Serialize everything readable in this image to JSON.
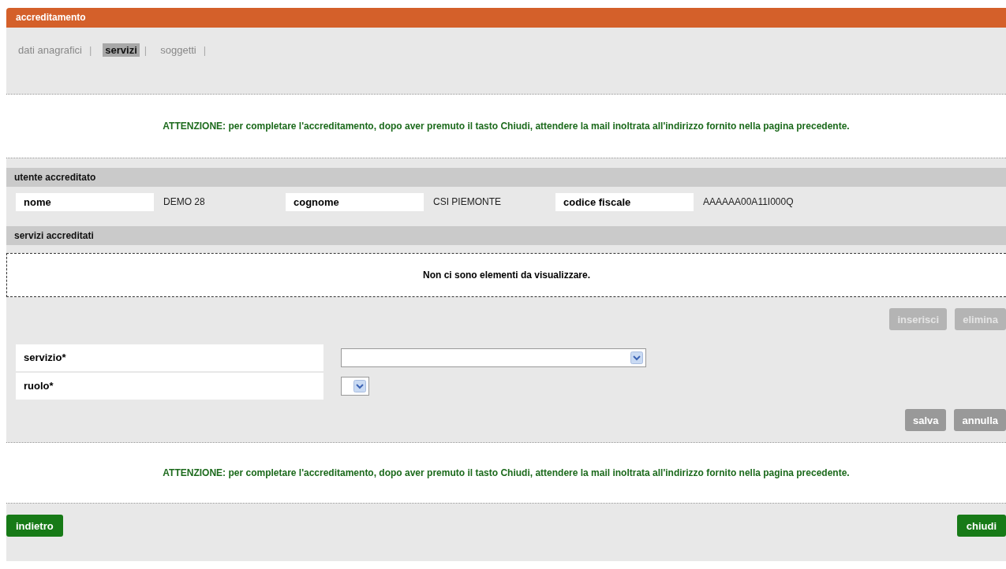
{
  "window": {
    "title": "accreditamento"
  },
  "tabs": [
    {
      "label": "dati anagrafici",
      "selected": false,
      "separator": "|"
    },
    {
      "label": "servizi",
      "selected": true,
      "separator": "|"
    },
    {
      "label": "soggetti",
      "selected": false,
      "separator": "|"
    }
  ],
  "notice_top": "ATTENZIONE: per completare l'accreditamento, dopo aver premuto il tasto Chiudi, attendere la mail inoltrata all'indirizzo fornito nella pagina precedente.",
  "user_section": {
    "title": "utente accreditato",
    "fields": [
      {
        "label": "nome",
        "value": "DEMO 28"
      },
      {
        "label": "cognome",
        "value": "CSI PIEMONTE"
      },
      {
        "label": "codice fiscale",
        "value": "AAAAAA00A11I000Q"
      }
    ]
  },
  "services_section": {
    "title": "servizi accreditati",
    "empty_message": "Non ci sono elementi da visualizzare."
  },
  "list_buttons": [
    {
      "label": "inserisci",
      "disabled": true
    },
    {
      "label": "elimina",
      "disabled": true
    }
  ],
  "form": [
    {
      "label": "servizio*",
      "kind": "wide"
    },
    {
      "label": "ruolo*",
      "kind": "narrow"
    }
  ],
  "form_buttons": [
    {
      "label": "salva",
      "disabled": false
    },
    {
      "label": "annulla",
      "disabled": false
    }
  ],
  "notice_bottom": "ATTENZIONE: per completare l'accreditamento, dopo aver premuto il tasto Chiudi, attendere la mail inoltrata all'indirizzo fornito nella pagina precedente.",
  "nav_buttons": [
    {
      "label": "indietro"
    },
    {
      "label": "chiudi"
    }
  ]
}
